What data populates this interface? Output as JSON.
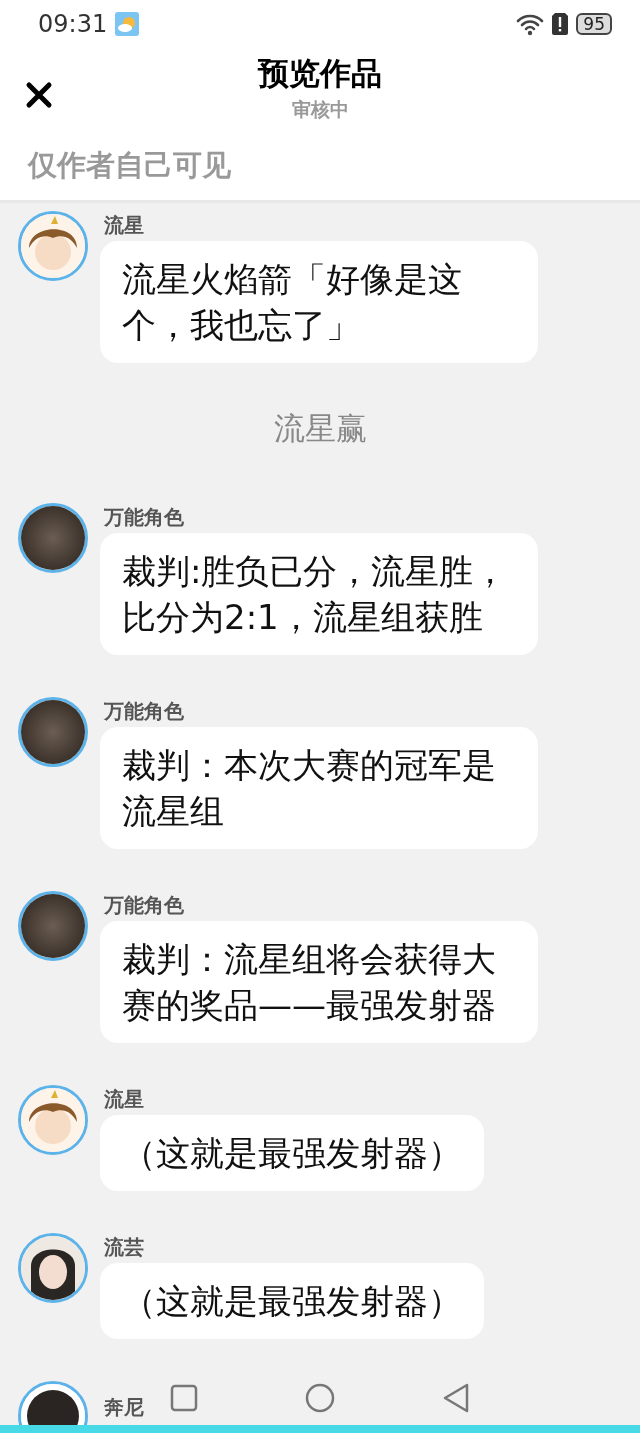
{
  "status_bar": {
    "time": "09:31",
    "battery": "95"
  },
  "header": {
    "title": "预览作品",
    "subtitle": "审核中",
    "notice": "仅作者自己可见"
  },
  "messages": [
    {
      "kind": "chat",
      "avatar": {
        "kind": "boy"
      },
      "name": "流星",
      "text": "流星火焰箭「好像是这个，我也忘了」"
    },
    {
      "kind": "narration",
      "text": "流星赢"
    },
    {
      "kind": "chat",
      "avatar": {
        "kind": "plain"
      },
      "name": "万能角色",
      "text": "裁判:胜负已分，流星胜，比分为2:1，流星组获胜"
    },
    {
      "kind": "chat",
      "avatar": {
        "kind": "plain"
      },
      "name": "万能角色",
      "text": "裁判：本次大赛的冠军是流星组"
    },
    {
      "kind": "chat",
      "avatar": {
        "kind": "plain"
      },
      "name": "万能角色",
      "text": "裁判：流星组将会获得大赛的奖品——最强发射器"
    },
    {
      "kind": "chat",
      "avatar": {
        "kind": "boy"
      },
      "name": "流星",
      "text": "（这就是最强发射器）"
    },
    {
      "kind": "chat",
      "avatar": {
        "kind": "girl"
      },
      "name": "流芸",
      "text": "（这就是最强发射器）"
    },
    {
      "kind": "chat",
      "avatar": {
        "kind": "dark"
      },
      "name": "奔尼"
    }
  ]
}
